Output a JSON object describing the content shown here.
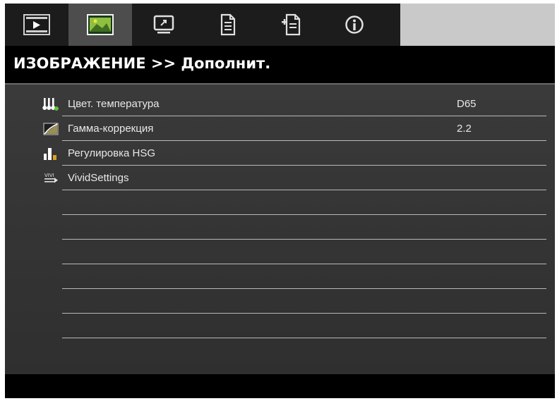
{
  "tabs": [
    {
      "icon": "play-icon",
      "active": false
    },
    {
      "icon": "image-icon",
      "active": true
    },
    {
      "icon": "display-icon",
      "active": false
    },
    {
      "icon": "settings-page-icon",
      "active": false
    },
    {
      "icon": "settings-plus-icon",
      "active": false
    },
    {
      "icon": "info-icon",
      "active": false
    }
  ],
  "header": {
    "title": "ИЗОБРАЖЕНИЕ >> Дополнит."
  },
  "menu": {
    "items": [
      {
        "label": "Цвет. температура",
        "value": "D65",
        "icon": "color-temperature-icon"
      },
      {
        "label": "Гамма-коррекция",
        "value": "2.2",
        "icon": "gamma-icon"
      },
      {
        "label": "Регулировка HSG",
        "value": "",
        "icon": "hsg-icon"
      },
      {
        "label": "VividSettings",
        "value": "",
        "icon": "vivid-settings-icon"
      }
    ]
  },
  "colors": {
    "active_tab": "#4d4d4d",
    "title_bg": "#000000",
    "panel_bg": "#363636",
    "separator": "#b9b9b9"
  }
}
